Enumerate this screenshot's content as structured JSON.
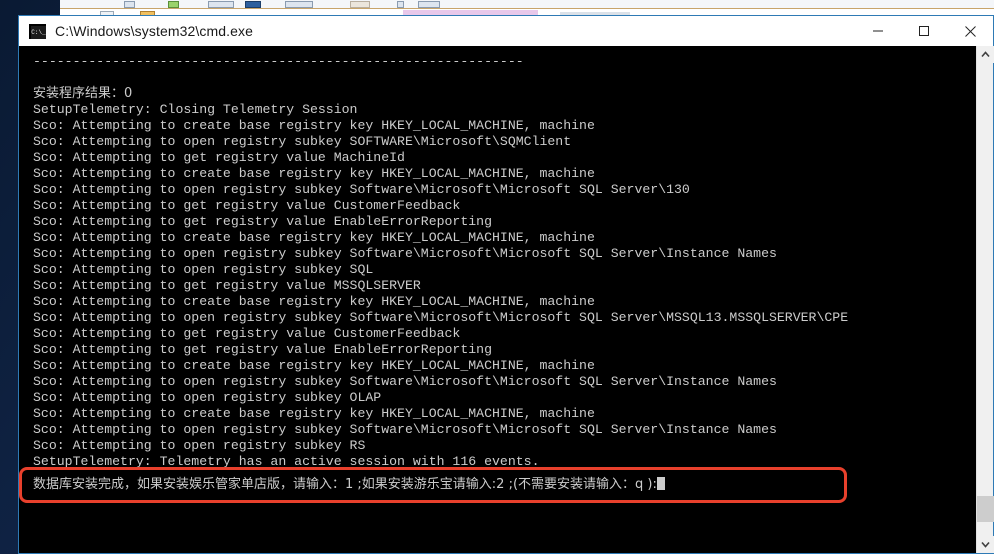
{
  "window": {
    "title": "C:\\Windows\\system32\\cmd.exe",
    "icon": "cmd-console-icon",
    "controls": {
      "minimize": "minimize-icon",
      "maximize": "maximize-icon",
      "close": "close-icon"
    }
  },
  "desktop": {
    "background_color": "#0d1f3c",
    "background_app_selection_color": "#e8c8ea"
  },
  "console": {
    "background_color": "#000000",
    "text_color": "#cccccc",
    "lines": [
      "--------------------------------------------------------------",
      "",
      "安装程序结果：0",
      "SetupTelemetry: Closing Telemetry Session",
      "Sco: Attempting to create base registry key HKEY_LOCAL_MACHINE, machine",
      "Sco: Attempting to open registry subkey SOFTWARE\\Microsoft\\SQMClient",
      "Sco: Attempting to get registry value MachineId",
      "Sco: Attempting to create base registry key HKEY_LOCAL_MACHINE, machine",
      "Sco: Attempting to open registry subkey Software\\Microsoft\\Microsoft SQL Server\\130",
      "Sco: Attempting to get registry value CustomerFeedback",
      "Sco: Attempting to get registry value EnableErrorReporting",
      "Sco: Attempting to create base registry key HKEY_LOCAL_MACHINE, machine",
      "Sco: Attempting to open registry subkey Software\\Microsoft\\Microsoft SQL Server\\Instance Names",
      "Sco: Attempting to open registry subkey SQL",
      "Sco: Attempting to get registry value MSSQLSERVER",
      "Sco: Attempting to create base registry key HKEY_LOCAL_MACHINE, machine",
      "Sco: Attempting to open registry subkey Software\\Microsoft\\Microsoft SQL Server\\MSSQL13.MSSQLSERVER\\CPE",
      "Sco: Attempting to get registry value CustomerFeedback",
      "Sco: Attempting to get registry value EnableErrorReporting",
      "Sco: Attempting to create base registry key HKEY_LOCAL_MACHINE, machine",
      "Sco: Attempting to open registry subkey Software\\Microsoft\\Microsoft SQL Server\\Instance Names",
      "Sco: Attempting to open registry subkey OLAP",
      "Sco: Attempting to create base registry key HKEY_LOCAL_MACHINE, machine",
      "Sco: Attempting to open registry subkey Software\\Microsoft\\Microsoft SQL Server\\Instance Names",
      "Sco: Attempting to open registry subkey RS",
      "SetupTelemetry: Telemetry has an active session with 116 events."
    ],
    "prompt": {
      "text": "数据库安装完成，如果安装娱乐管家单店版，请输入：1 ;如果安装游乐宝请输入:2 ;(不需要安装请输入：q ):",
      "cursor": "block-cursor",
      "highlight_color": "#e8402c"
    }
  },
  "scrollbar": {
    "up_arrow": "chevron-up-icon",
    "down_arrow": "chevron-down-icon",
    "thumb": "scrollbar-thumb"
  }
}
